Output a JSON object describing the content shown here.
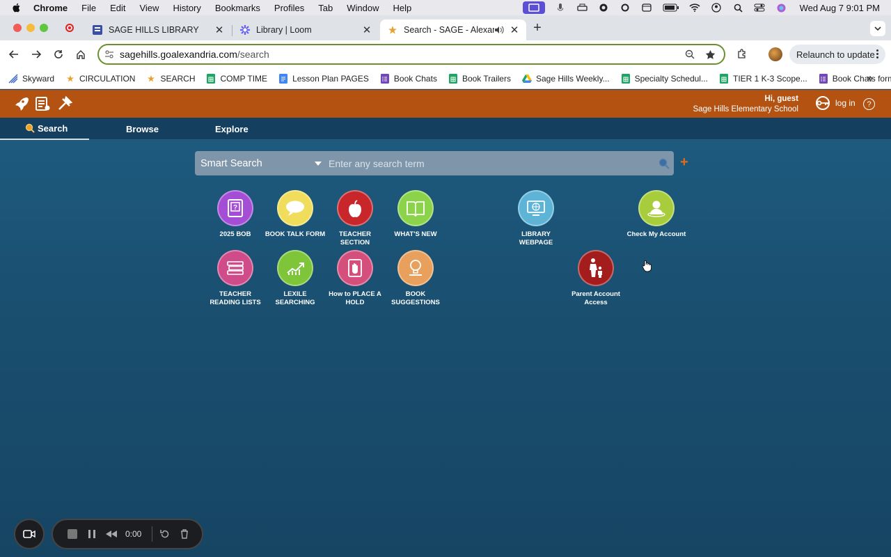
{
  "menubar": {
    "app": "Chrome",
    "items": [
      "File",
      "Edit",
      "View",
      "History",
      "Bookmarks",
      "Profiles",
      "Tab",
      "Window",
      "Help"
    ],
    "clock": "Wed Aug 7  9:01 PM"
  },
  "tabs": [
    {
      "title": "SAGE HILLS LIBRARY",
      "close": "✕"
    },
    {
      "title": "Library | Loom",
      "close": "✕"
    },
    {
      "title": "Search - SAGE - Alexandria",
      "close": "✕"
    }
  ],
  "new_tab": "+",
  "address": {
    "host": "sagehills.goalexandria.com",
    "path": "/search"
  },
  "relaunch": "Relaunch to update",
  "bookmarks": [
    {
      "label": "Skyward",
      "icon": "skyward-icon"
    },
    {
      "label": "CIRCULATION",
      "icon": "alexandria-icon"
    },
    {
      "label": "SEARCH",
      "icon": "alexandria-icon"
    },
    {
      "label": "COMP TIME",
      "icon": "sheets-icon"
    },
    {
      "label": "Lesson Plan PAGES",
      "icon": "docs-icon"
    },
    {
      "label": "Book Chats",
      "icon": "forms-icon"
    },
    {
      "label": "Book Trailers",
      "icon": "sheets-icon"
    },
    {
      "label": "Sage Hills Weekly...",
      "icon": "drive-icon"
    },
    {
      "label": "Specialty Schedul...",
      "icon": "sheets-icon"
    },
    {
      "label": "TIER 1 K-3 Scope...",
      "icon": "sheets-icon"
    },
    {
      "label": "Book Chats form",
      "icon": "forms-icon"
    }
  ],
  "bookmarks_more": "»",
  "header": {
    "greeting": "Hi, guest",
    "school": "Sage Hills Elementary School",
    "login": "log in",
    "help": "?"
  },
  "nav_tabs": {
    "search": "Search",
    "browse": "Browse",
    "explore": "Explore"
  },
  "search": {
    "mode": "Smart Search",
    "placeholder": "Enter any search term"
  },
  "add_symbol": "+",
  "tiles": [
    {
      "label": "2025 BOB",
      "color": "#a44ed6"
    },
    {
      "label": "BOOK TALK FORM",
      "color": "#f1dd5c"
    },
    {
      "label": "TEACHER SECTION",
      "color": "#c8262a"
    },
    {
      "label": "WHAT'S NEW",
      "color": "#8bd34b"
    },
    {
      "label": "LIBRARY WEBPAGE",
      "color": "#5db4d6"
    },
    {
      "label": "Check My Account",
      "color": "#a8cd3c"
    },
    {
      "label": "TEACHER READING LISTS",
      "color": "#d04b8a"
    },
    {
      "label": "LEXILE SEARCHING",
      "color": "#7ec53a"
    },
    {
      "label": "How to PLACE A HOLD",
      "color": "#d54f7c"
    },
    {
      "label": "BOOK SUGGESTIONS",
      "color": "#e8a05c"
    },
    {
      "label": "Parent Account Access",
      "color": "#a41d1d"
    }
  ],
  "recorder": {
    "time": "0:00"
  }
}
